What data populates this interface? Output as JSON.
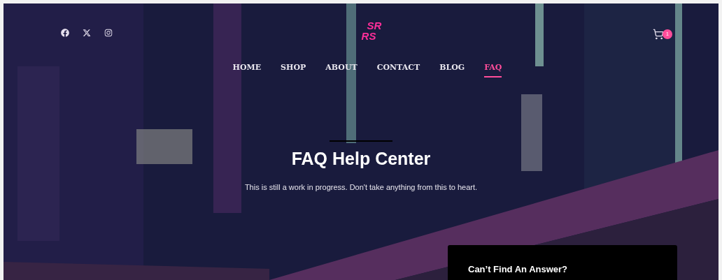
{
  "header": {
    "social": [
      {
        "kind": "facebook"
      },
      {
        "kind": "x"
      },
      {
        "kind": "instagram"
      }
    ],
    "logo": [
      "SR",
      "RS"
    ],
    "cart": {
      "count": "1"
    }
  },
  "nav": [
    {
      "label": "HOME",
      "selected": false
    },
    {
      "label": "SHOP",
      "selected": false
    },
    {
      "label": "ABOUT",
      "selected": false
    },
    {
      "label": "CONTACT",
      "selected": false
    },
    {
      "label": "BLOG",
      "selected": false
    },
    {
      "label": "FAQ",
      "selected": true
    }
  ],
  "hero": {
    "title": "FAQ Help Center",
    "subtitle": "This is still a work in progress. Don't take anything from this to heart."
  },
  "card": {
    "title": "Can’t Find An Answer?"
  }
}
